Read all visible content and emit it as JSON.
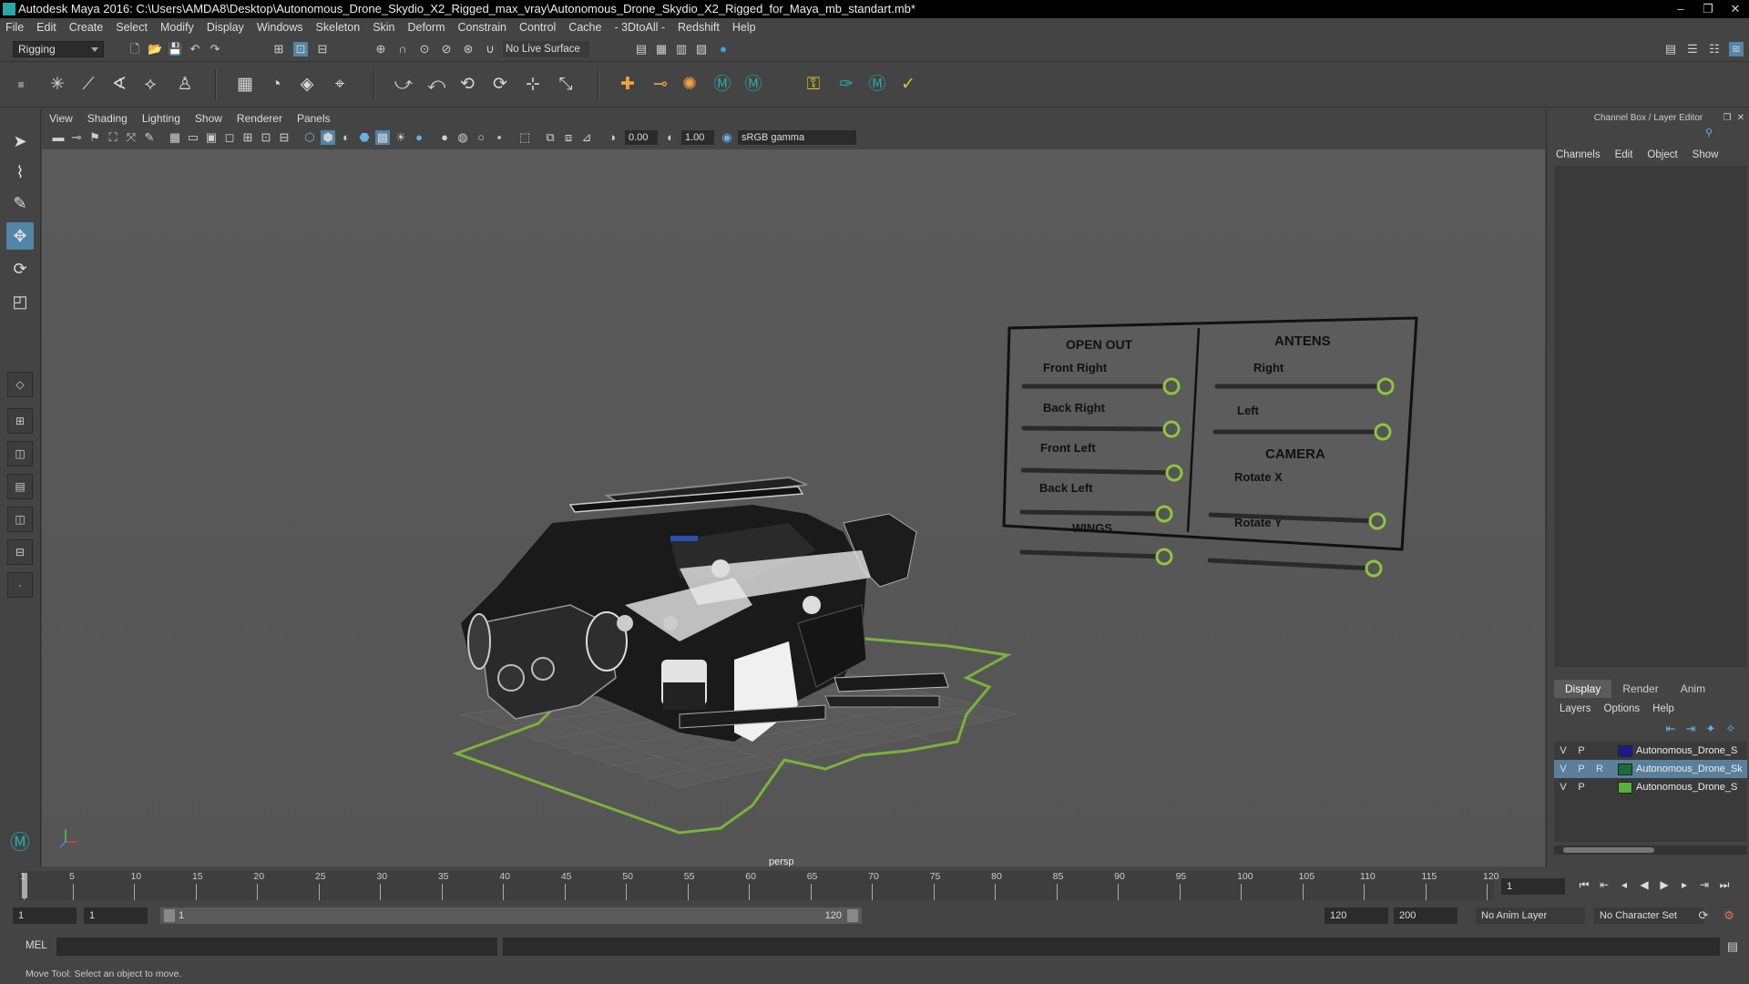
{
  "window": {
    "title": "Autodesk Maya 2016: C:\\Users\\AMDA8\\Desktop\\Autonomous_Drone_Skydio_X2_Rigged_max_vray\\Autonomous_Drone_Skydio_X2_Rigged_for_Maya_mb_standart.mb*",
    "minimize": "‒",
    "maximize": "❐",
    "close": "✕"
  },
  "menubar": [
    "File",
    "Edit",
    "Create",
    "Select",
    "Modify",
    "Display",
    "Windows",
    "Skeleton",
    "Skin",
    "Deform",
    "Constrain",
    "Control",
    "Cache",
    "- 3DtoAll -",
    "Redshift",
    "Help"
  ],
  "statusline": {
    "mode": "Rigging",
    "live_surface": "No Live Surface"
  },
  "viewport": {
    "menu": [
      "View",
      "Shading",
      "Lighting",
      "Show",
      "Renderer",
      "Panels"
    ],
    "field_a": "0.00",
    "field_b": "1.00",
    "color_space": "sRGB gamma",
    "camera": "persp"
  },
  "control_board": {
    "open_out_title": "OPEN OUT",
    "antens_title": "ANTENS",
    "camera_title": "CAMERA",
    "front_right": "Front Right",
    "back_right": "Back Right",
    "front_left": "Front Left",
    "back_left": "Back Left",
    "wings": "WINGS",
    "right": "Right",
    "left": "Left",
    "rotate_x": "Rotate X",
    "rotate_y": "Rotate Y"
  },
  "right_panel": {
    "title": "Channel Box / Layer Editor",
    "menu": [
      "Channels",
      "Edit",
      "Object",
      "Show"
    ],
    "tabs": [
      "Display",
      "Render",
      "Anim"
    ],
    "layer_menu": [
      "Layers",
      "Options",
      "Help"
    ],
    "layers": [
      {
        "v": "V",
        "p": "P",
        "r": "",
        "name": "Autonomous_Drone_S",
        "color": "#1a1a8c"
      },
      {
        "v": "V",
        "p": "P",
        "r": "R",
        "name": "Autonomous_Drone_Sk",
        "color": "#1e6b3a"
      },
      {
        "v": "V",
        "p": "P",
        "r": "",
        "name": "Autonomous_Drone_S",
        "color": "#56b03a"
      }
    ]
  },
  "timeline": {
    "ticks": [
      "1",
      "5",
      "10",
      "15",
      "20",
      "25",
      "30",
      "35",
      "40",
      "45",
      "50",
      "55",
      "60",
      "65",
      "70",
      "75",
      "80",
      "85",
      "90",
      "95",
      "100",
      "105",
      "110",
      "115",
      "120"
    ],
    "current_frame": "1",
    "range_start": "1",
    "range_start_inner": "1",
    "slider_start": "1",
    "slider_end": "120",
    "range_end": "120",
    "anim_end": "200",
    "anim_layer": "No Anim Layer",
    "character_set": "No Character Set"
  },
  "cmdline": {
    "label": "MEL"
  },
  "helpline": {
    "text": "Move Tool: Select an object to move."
  },
  "colors": {
    "accent": "#5285a6",
    "ground_outline": "#7bb23a",
    "slider_ring": "#8dc63f"
  }
}
